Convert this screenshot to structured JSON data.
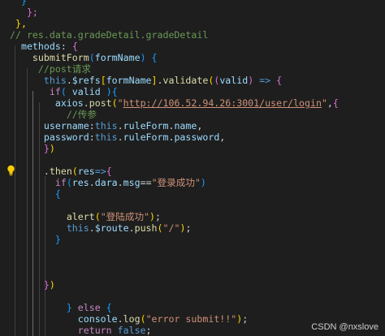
{
  "editor": {
    "theme": "dark",
    "background": "#1e1e1e",
    "lines": [
      {
        "indent": "  ",
        "tokens": [
          {
            "t": "}",
            "c": "b3"
          }
        ]
      },
      {
        "indent": "   ",
        "tokens": [
          {
            "t": "};",
            "c": "b2"
          }
        ]
      },
      {
        "indent": " ",
        "tokens": [
          {
            "t": "},",
            "c": "b1"
          }
        ]
      },
      {
        "indent": "",
        "tokens": [
          {
            "t": "// res.data.gradeDetail.gradeDetail",
            "c": "cmt"
          }
        ]
      },
      {
        "indent": "  ",
        "tokens": [
          {
            "t": "methods",
            "c": "prop"
          },
          {
            "t": ": ",
            "c": "punc"
          },
          {
            "t": "{",
            "c": "b2"
          }
        ]
      },
      {
        "indent": "    ",
        "tokens": [
          {
            "t": "submitForm",
            "c": "fn"
          },
          {
            "t": "(",
            "c": "b3"
          },
          {
            "t": "formName",
            "c": "var"
          },
          {
            "t": ")",
            "c": "b3"
          },
          {
            "t": " ",
            "c": "punc"
          },
          {
            "t": "{",
            "c": "b3"
          }
        ]
      },
      {
        "indent": "     ",
        "tokens": [
          {
            "t": "//post请求",
            "c": "cmt"
          }
        ]
      },
      {
        "indent": "      ",
        "tokens": [
          {
            "t": "this",
            "c": "kw"
          },
          {
            "t": ".",
            "c": "punc"
          },
          {
            "t": "$refs",
            "c": "prop"
          },
          {
            "t": "[",
            "c": "b1"
          },
          {
            "t": "formName",
            "c": "var"
          },
          {
            "t": "]",
            "c": "b1"
          },
          {
            "t": ".",
            "c": "punc"
          },
          {
            "t": "validate",
            "c": "fn"
          },
          {
            "t": "(",
            "c": "b1"
          },
          {
            "t": "(",
            "c": "b2"
          },
          {
            "t": "valid",
            "c": "var"
          },
          {
            "t": ")",
            "c": "b2"
          },
          {
            "t": " ",
            "c": "punc"
          },
          {
            "t": "=>",
            "c": "kw"
          },
          {
            "t": " ",
            "c": "punc"
          },
          {
            "t": "{",
            "c": "b2"
          }
        ]
      },
      {
        "indent": "       ",
        "tokens": [
          {
            "t": "if",
            "c": "kw2"
          },
          {
            "t": "(",
            "c": "b3"
          },
          {
            "t": " valid ",
            "c": "var"
          },
          {
            "t": ")",
            "c": "b3"
          },
          {
            "t": "{",
            "c": "b3"
          }
        ]
      },
      {
        "indent": "        ",
        "tokens": [
          {
            "t": "axios",
            "c": "var"
          },
          {
            "t": ".",
            "c": "punc"
          },
          {
            "t": "post",
            "c": "fn"
          },
          {
            "t": "(",
            "c": "b1"
          },
          {
            "t": "\"",
            "c": "str"
          },
          {
            "t": "http://106.52.94.26:3001/user/login",
            "c": "url"
          },
          {
            "t": "\"",
            "c": "str"
          },
          {
            "t": ",",
            "c": "punc"
          },
          {
            "t": "{",
            "c": "b2"
          }
        ]
      },
      {
        "indent": "          ",
        "tokens": [
          {
            "t": "//传参",
            "c": "cmt"
          }
        ]
      },
      {
        "indent": "      ",
        "tokens": [
          {
            "t": "username",
            "c": "prop"
          },
          {
            "t": ":",
            "c": "punc"
          },
          {
            "t": "this",
            "c": "kw"
          },
          {
            "t": ".",
            "c": "punc"
          },
          {
            "t": "ruleForm",
            "c": "prop"
          },
          {
            "t": ".",
            "c": "punc"
          },
          {
            "t": "name",
            "c": "prop"
          },
          {
            "t": ",",
            "c": "punc"
          }
        ]
      },
      {
        "indent": "      ",
        "tokens": [
          {
            "t": "password",
            "c": "prop"
          },
          {
            "t": ":",
            "c": "punc"
          },
          {
            "t": "this",
            "c": "kw"
          },
          {
            "t": ".",
            "c": "punc"
          },
          {
            "t": "ruleForm",
            "c": "prop"
          },
          {
            "t": ".",
            "c": "punc"
          },
          {
            "t": "password",
            "c": "prop"
          },
          {
            "t": ",",
            "c": "punc"
          }
        ]
      },
      {
        "indent": "      ",
        "tokens": [
          {
            "t": "}",
            "c": "b2"
          },
          {
            "t": ")",
            "c": "b1"
          }
        ]
      },
      {
        "indent": "",
        "tokens": []
      },
      {
        "indent": "      ",
        "tokens": [
          {
            "t": ".",
            "c": "punc"
          },
          {
            "t": "then",
            "c": "fn"
          },
          {
            "t": "(",
            "c": "b1"
          },
          {
            "t": "res",
            "c": "var"
          },
          {
            "t": "=>",
            "c": "kw"
          },
          {
            "t": "{",
            "c": "b2"
          }
        ]
      },
      {
        "indent": "        ",
        "tokens": [
          {
            "t": "if",
            "c": "kw2"
          },
          {
            "t": "(",
            "c": "b3"
          },
          {
            "t": "res",
            "c": "var"
          },
          {
            "t": ".",
            "c": "punc"
          },
          {
            "t": "dara",
            "c": "prop"
          },
          {
            "t": ".",
            "c": "punc"
          },
          {
            "t": "msg",
            "c": "prop"
          },
          {
            "t": "==",
            "c": "punc"
          },
          {
            "t": "\"登录成功\"",
            "c": "str"
          },
          {
            "t": ")",
            "c": "b3"
          }
        ]
      },
      {
        "indent": "        ",
        "tokens": [
          {
            "t": "{",
            "c": "b3"
          }
        ]
      },
      {
        "indent": "",
        "tokens": []
      },
      {
        "indent": "          ",
        "tokens": [
          {
            "t": "alert",
            "c": "fn"
          },
          {
            "t": "(",
            "c": "b1"
          },
          {
            "t": "\"登陆成功\"",
            "c": "str"
          },
          {
            "t": ")",
            "c": "b1"
          },
          {
            "t": ";",
            "c": "punc"
          }
        ]
      },
      {
        "indent": "          ",
        "tokens": [
          {
            "t": "this",
            "c": "kw"
          },
          {
            "t": ".",
            "c": "punc"
          },
          {
            "t": "$route",
            "c": "prop"
          },
          {
            "t": ".",
            "c": "punc"
          },
          {
            "t": "push",
            "c": "fn"
          },
          {
            "t": "(",
            "c": "b1"
          },
          {
            "t": "\"/\"",
            "c": "str"
          },
          {
            "t": ")",
            "c": "b1"
          },
          {
            "t": ";",
            "c": "punc"
          }
        ]
      },
      {
        "indent": "        ",
        "tokens": [
          {
            "t": "}",
            "c": "b3"
          }
        ]
      },
      {
        "indent": "",
        "tokens": []
      },
      {
        "indent": "",
        "tokens": []
      },
      {
        "indent": "",
        "tokens": []
      },
      {
        "indent": "      ",
        "tokens": [
          {
            "t": "}",
            "c": "b2"
          },
          {
            "t": ")",
            "c": "b1"
          }
        ]
      },
      {
        "indent": "",
        "tokens": []
      },
      {
        "indent": "          ",
        "tokens": [
          {
            "t": "}",
            "c": "b3"
          },
          {
            "t": " ",
            "c": "punc"
          },
          {
            "t": "else",
            "c": "kw2"
          },
          {
            "t": " ",
            "c": "punc"
          },
          {
            "t": "{",
            "c": "b3"
          }
        ]
      },
      {
        "indent": "            ",
        "tokens": [
          {
            "t": "console",
            "c": "var"
          },
          {
            "t": ".",
            "c": "punc"
          },
          {
            "t": "log",
            "c": "fn"
          },
          {
            "t": "(",
            "c": "b1"
          },
          {
            "t": "\"error submit!!\"",
            "c": "str"
          },
          {
            "t": ")",
            "c": "b1"
          },
          {
            "t": ";",
            "c": "punc"
          }
        ]
      },
      {
        "indent": "            ",
        "tokens": [
          {
            "t": "return",
            "c": "kw2"
          },
          {
            "t": " ",
            "c": "punc"
          },
          {
            "t": "false",
            "c": "kw"
          },
          {
            "t": ";",
            "c": "punc"
          }
        ]
      },
      {
        "indent": "          ",
        "tokens": [
          {
            "t": "}",
            "c": "b3"
          }
        ]
      }
    ]
  },
  "lightbulb_icon": "lightbulb-icon",
  "watermark": {
    "text": "CSDN @nxslove"
  }
}
